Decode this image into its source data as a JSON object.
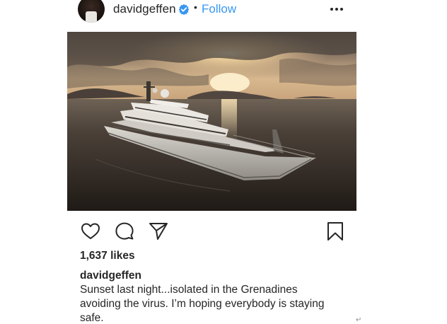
{
  "header": {
    "username": "davidgeffen",
    "separator": "•",
    "follow_label": "Follow",
    "verified_icon": "verified-badge-icon",
    "more_icon": "more-options-icon"
  },
  "post": {
    "image_description_icon": "yacht-sunset-photo",
    "actions": {
      "like_icon": "heart-icon",
      "comment_icon": "comment-icon",
      "share_icon": "share-icon",
      "save_icon": "bookmark-icon"
    },
    "likes": "1,637 likes",
    "caption_username": "davidgeffen",
    "caption_line1": "Sunset last night...isolated in the Grenadines",
    "caption_line2": "avoiding the virus. I’m hoping everybody is staying",
    "caption_line3": "safe."
  },
  "colors": {
    "link": "#3897f0",
    "text": "#262626",
    "verified": "#3897f0"
  },
  "return_mark": "↵"
}
